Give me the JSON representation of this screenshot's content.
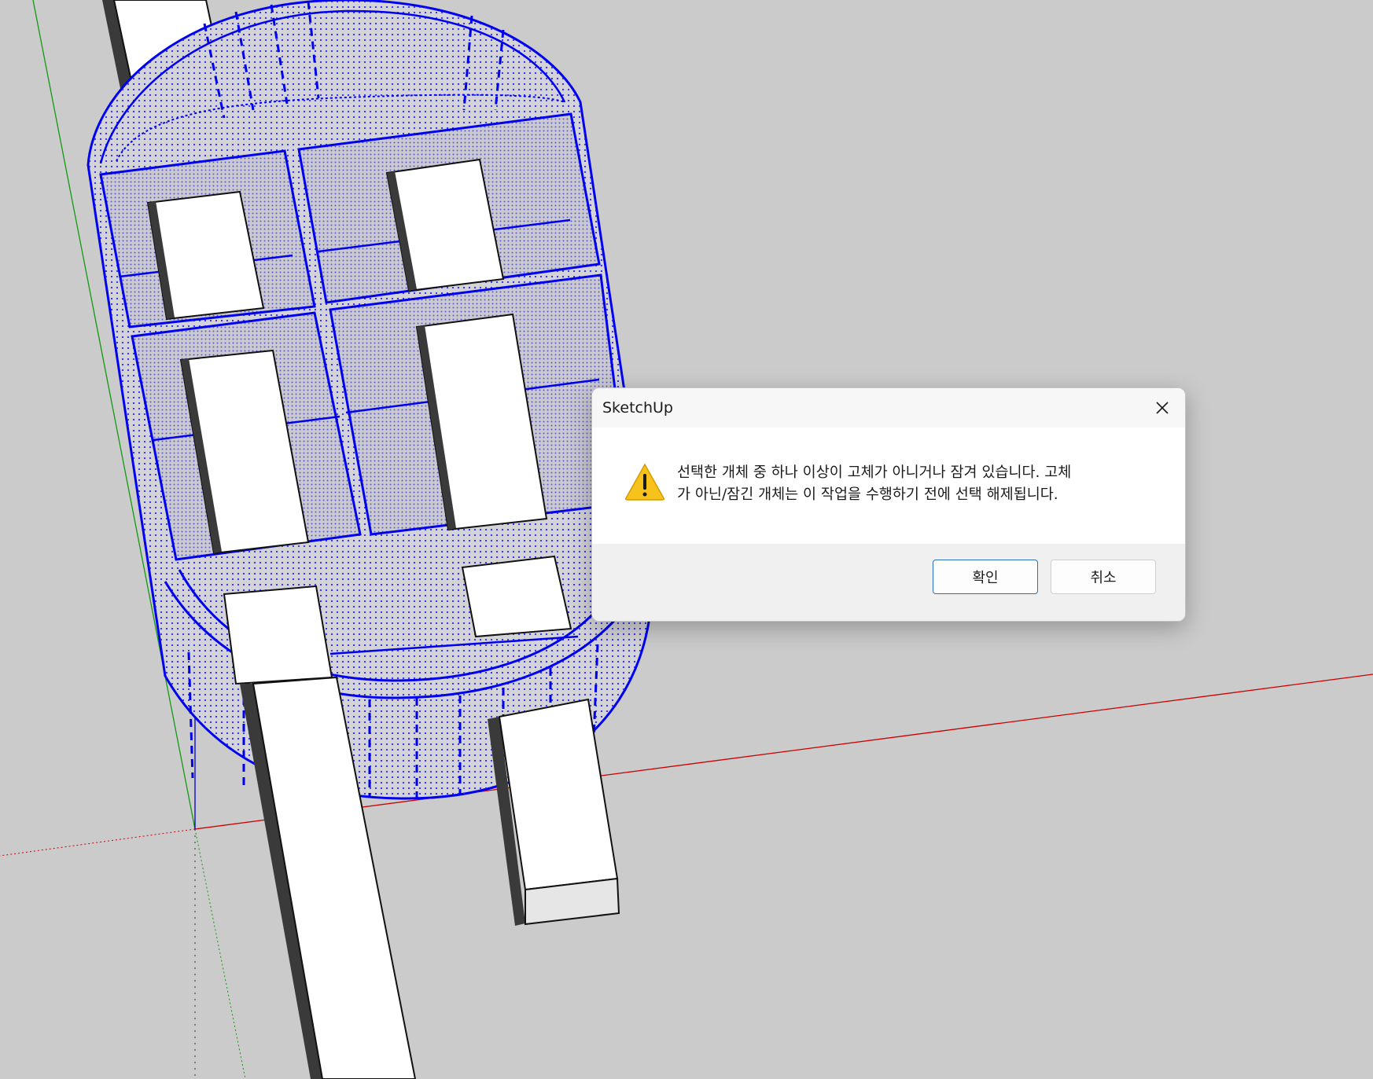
{
  "dialog": {
    "title": "SketchUp",
    "message_line1": "선택한 개체 중 하나 이상이 고체가 아니거나 잠겨 있습니다. 고체",
    "message_line2": "가 아닌/잠긴 개체는 이 작업을 수행하기 전에 선택 해제됩니다.",
    "ok_label": "확인",
    "cancel_label": "취소",
    "icon": "warning-icon",
    "close_icon": "close-icon"
  },
  "colors": {
    "viewport_bg": "#cbcbcb",
    "selection": "#0000ee",
    "red_axis": "#cc0000",
    "green_axis": "#119911",
    "blue_axis": "#0000cc",
    "primary_border": "#2d6fb6",
    "warning": "#f7c21b"
  }
}
